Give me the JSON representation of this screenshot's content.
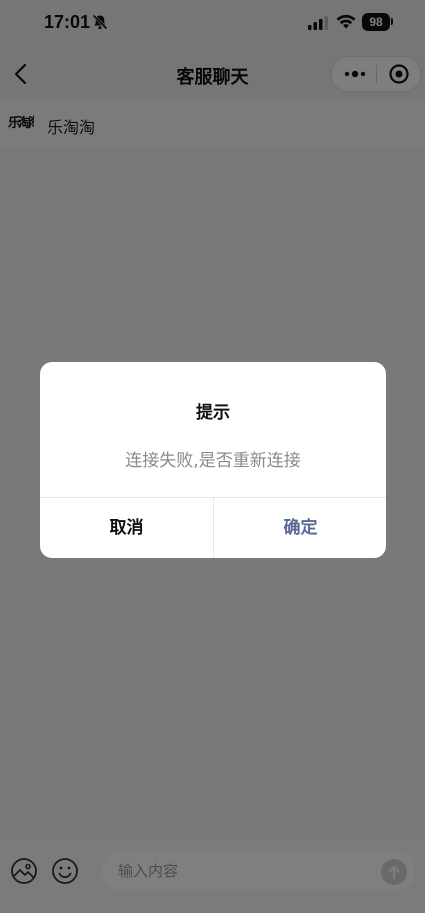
{
  "status_bar": {
    "time": "17:01",
    "battery": "98",
    "icons": [
      "bell-muted-icon",
      "signal-icon",
      "wifi-icon",
      "battery-icon"
    ]
  },
  "nav": {
    "title": "客服聊天",
    "icons": [
      "back-chevron-icon",
      "more-dots-icon",
      "close-target-icon"
    ]
  },
  "shop": {
    "logo_text": "乐淘淘",
    "name": "乐淘淘"
  },
  "input_bar": {
    "placeholder": "输入内容",
    "icons": [
      "image-icon",
      "emoji-icon",
      "send-arrow-icon"
    ]
  },
  "dialog": {
    "title": "提示",
    "content": "连接失败,是否重新连接",
    "cancel_label": "取消",
    "confirm_label": "确定",
    "confirm_color": "#576b95"
  },
  "colors": {
    "overlay": "rgba(0,0,0,0.5)",
    "page_bg": "#f2f2f2"
  }
}
